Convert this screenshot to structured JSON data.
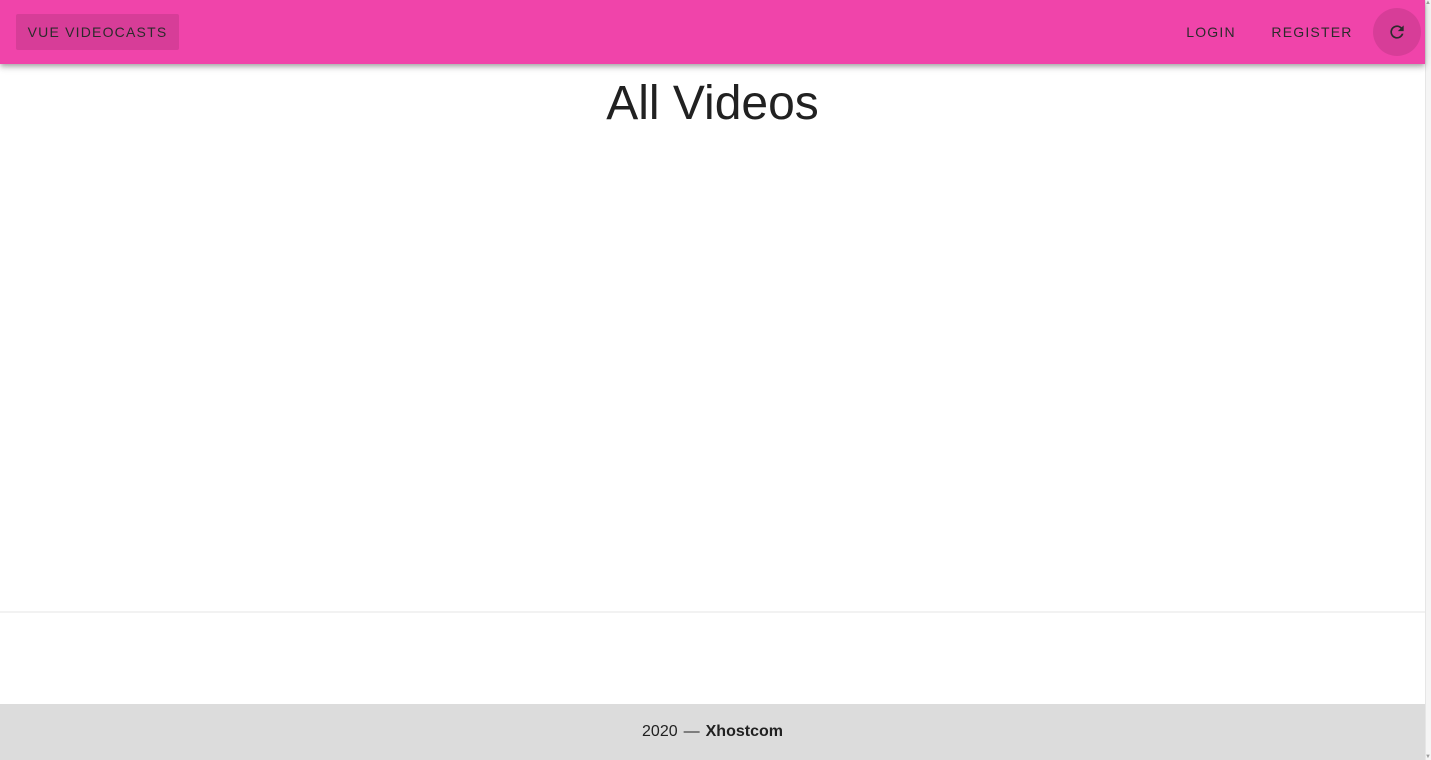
{
  "toolbar": {
    "brand_label": "Vue Videocasts",
    "login_label": "Login",
    "register_label": "Register",
    "refresh_icon": "refresh-icon",
    "color": "#f044aa"
  },
  "main": {
    "title": "All Videos"
  },
  "footer": {
    "year": "2020",
    "separator": "—",
    "company": "Xhostcom",
    "color": "#dcdcdc"
  }
}
